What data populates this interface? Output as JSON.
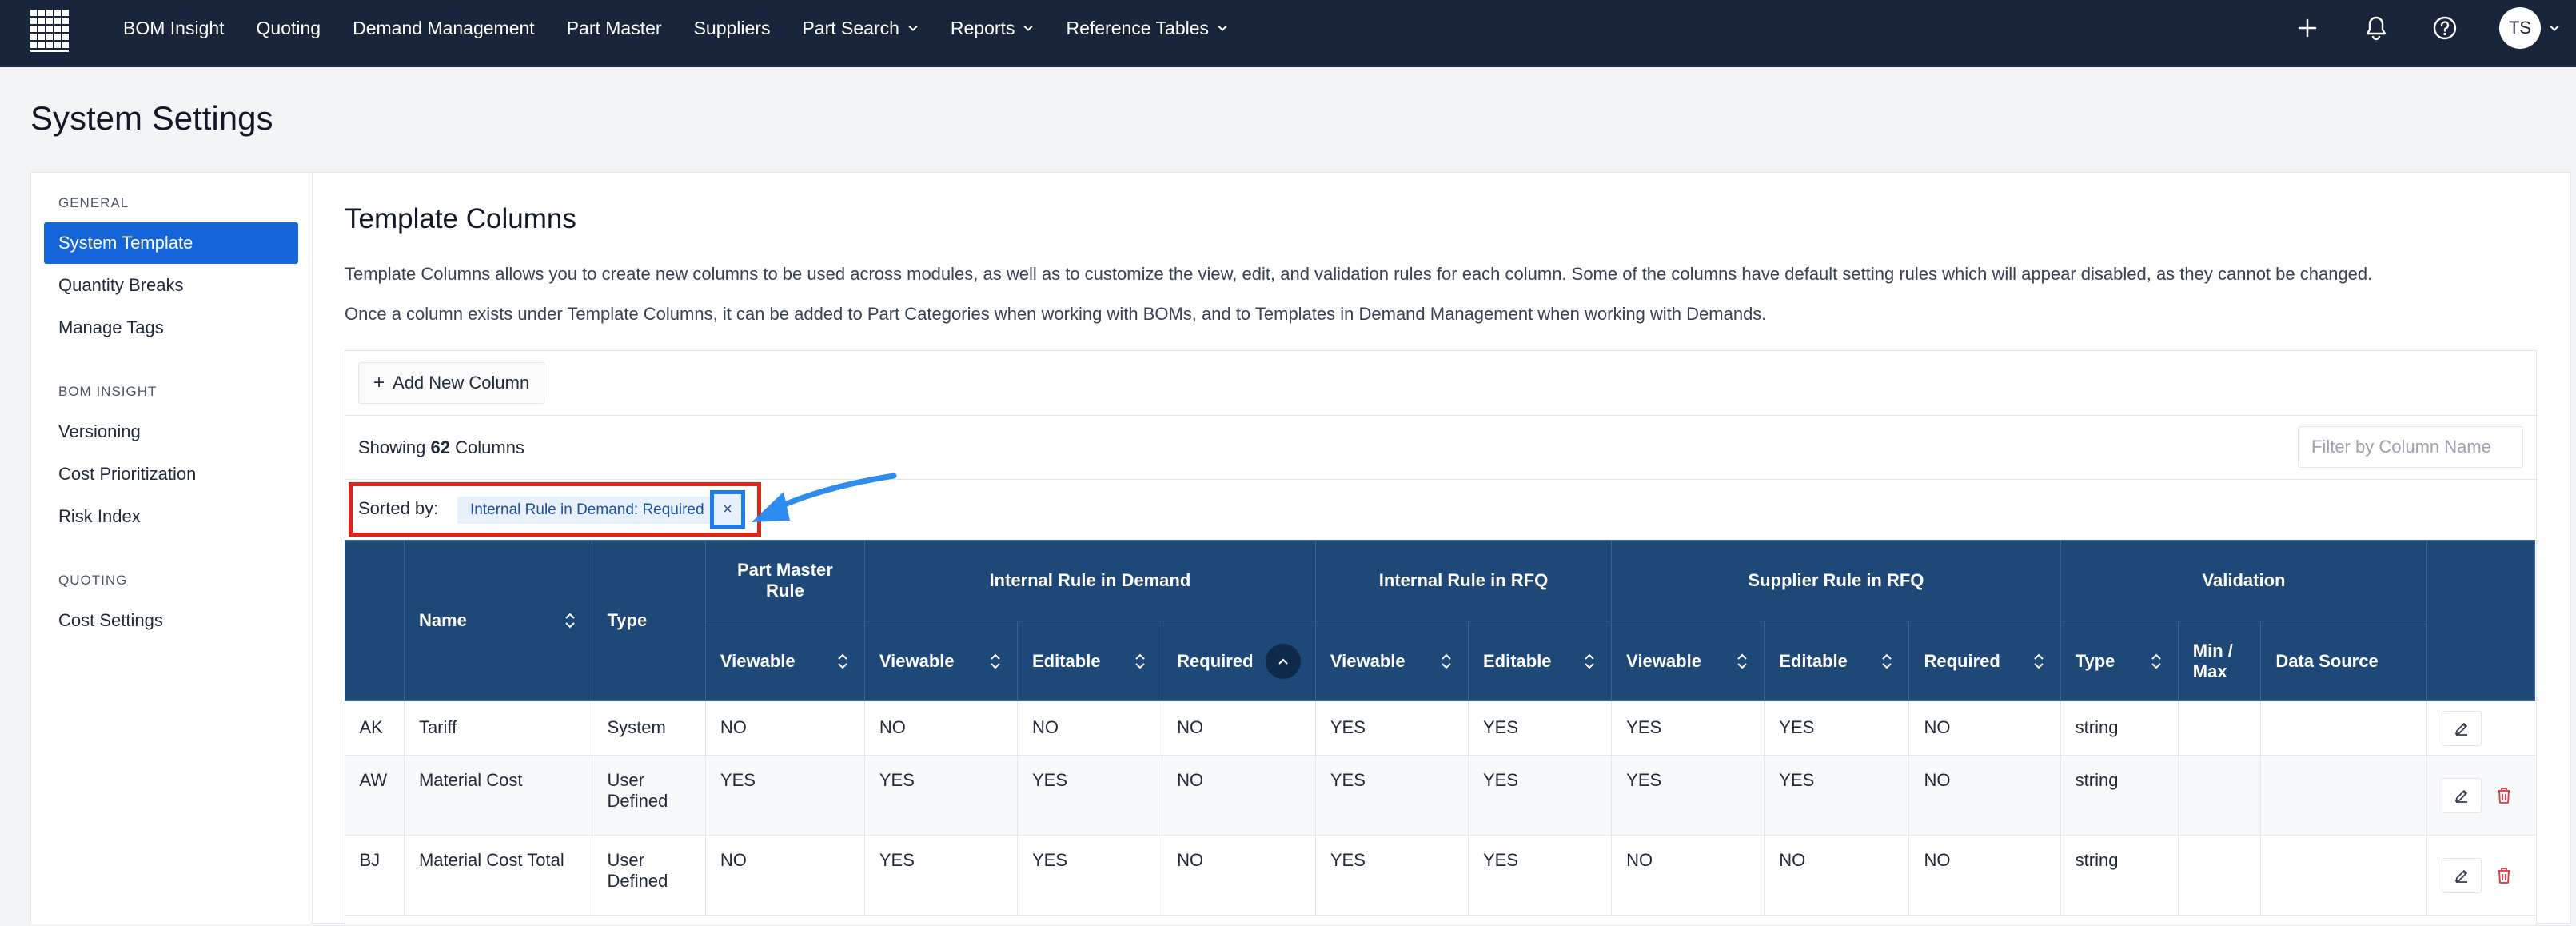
{
  "nav": {
    "items": [
      {
        "label": "BOM Insight",
        "has_dropdown": false
      },
      {
        "label": "Quoting",
        "has_dropdown": false
      },
      {
        "label": "Demand Management",
        "has_dropdown": false
      },
      {
        "label": "Part Master",
        "has_dropdown": false
      },
      {
        "label": "Suppliers",
        "has_dropdown": false
      },
      {
        "label": "Part Search",
        "has_dropdown": true
      },
      {
        "label": "Reports",
        "has_dropdown": true
      },
      {
        "label": "Reference Tables",
        "has_dropdown": true
      }
    ],
    "avatar": "TS",
    "icons": [
      "plus-icon",
      "bell-icon",
      "help-icon"
    ]
  },
  "page": {
    "title": "System Settings"
  },
  "sidebar": {
    "sections": [
      {
        "label": "GENERAL",
        "items": [
          "System Template",
          "Quantity Breaks",
          "Manage Tags"
        ]
      },
      {
        "label": "BOM INSIGHT",
        "items": [
          "Versioning",
          "Cost Prioritization",
          "Risk Index"
        ]
      },
      {
        "label": "QUOTING",
        "items": [
          "Cost Settings"
        ]
      }
    ],
    "active": "System Template"
  },
  "content": {
    "title": "Template Columns",
    "desc1": "Template Columns allows you to create new columns to be used across modules, as well as to customize the view, edit, and validation rules for each column. Some of the columns have default setting rules which will appear disabled, as they cannot be changed.",
    "desc2": "Once a column exists under Template Columns, it can be added to Part Categories when working with BOMs, and to Templates in Demand Management when working with Demands.",
    "add_button": "Add New Column",
    "showing_prefix": "Showing",
    "showing_count": "62",
    "showing_suffix": "Columns",
    "filter_placeholder": "Filter by Column Name",
    "sorted_label": "Sorted by:",
    "sort_chip": "Internal Rule in Demand: Required",
    "chip_close": "×"
  },
  "table": {
    "group_headers": {
      "name": "Name",
      "type": "Type",
      "part_master": "Part Master Rule",
      "internal_demand": "Internal Rule in Demand",
      "internal_rfq": "Internal Rule in RFQ",
      "supplier_rfq": "Supplier Rule in RFQ",
      "validation": "Validation"
    },
    "sub_headers": {
      "pm_viewable": "Viewable",
      "id_viewable": "Viewable",
      "id_editable": "Editable",
      "id_required": "Required",
      "ir_viewable": "Viewable",
      "ir_editable": "Editable",
      "sr_viewable": "Viewable",
      "sr_editable": "Editable",
      "sr_required": "Required",
      "v_type": "Type",
      "v_minmax": "Min / Max",
      "v_source": "Data Source"
    },
    "rows": [
      {
        "code": "AK",
        "name": "Tariff",
        "type": "System",
        "pm_viewable": "NO",
        "id_viewable": "NO",
        "id_editable": "NO",
        "id_required": "NO",
        "ir_viewable": "YES",
        "ir_editable": "YES",
        "sr_viewable": "YES",
        "sr_editable": "YES",
        "sr_required": "NO",
        "v_type": "string",
        "v_minmax": "",
        "v_source": ""
      },
      {
        "code": "AW",
        "name": "Material Cost",
        "type": "User Defined",
        "pm_viewable": "YES",
        "id_viewable": "YES",
        "id_editable": "YES",
        "id_required": "NO",
        "ir_viewable": "YES",
        "ir_editable": "YES",
        "sr_viewable": "YES",
        "sr_editable": "YES",
        "sr_required": "NO",
        "v_type": "string",
        "v_minmax": "",
        "v_source": ""
      },
      {
        "code": "BJ",
        "name": "Material Cost Total",
        "type": "User Defined",
        "pm_viewable": "NO",
        "id_viewable": "YES",
        "id_editable": "YES",
        "id_required": "NO",
        "ir_viewable": "YES",
        "ir_editable": "YES",
        "sr_viewable": "NO",
        "sr_editable": "NO",
        "sr_required": "NO",
        "v_type": "string",
        "v_minmax": "",
        "v_source": ""
      }
    ]
  },
  "colors": {
    "nav_bg": "#19253a",
    "accent": "#1565d8",
    "table_header": "#1e4877",
    "highlight_red": "#e1251b",
    "highlight_blue": "#1e7bf0",
    "delete": "#d9363e"
  }
}
